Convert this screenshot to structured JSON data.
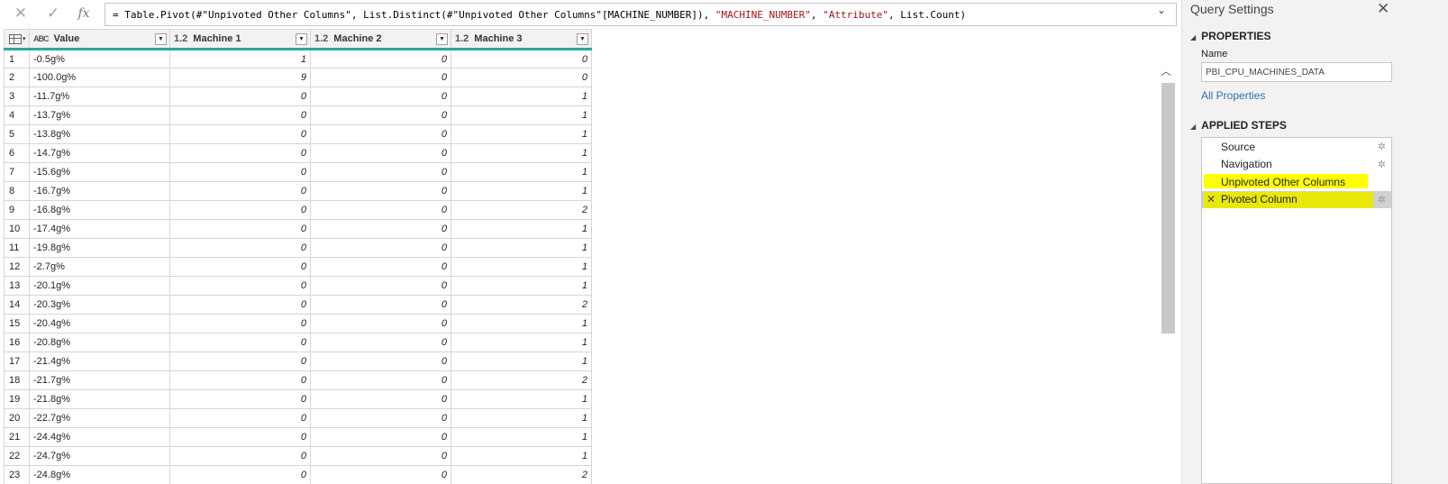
{
  "formula_bar": {
    "cancel_icon": "close-icon",
    "commit_icon": "check-icon",
    "fx_label": "fx",
    "formula_parts": [
      {
        "text": "= Table.Pivot(#\"Unpivoted Other Columns\", List.Distinct(#\"Unpivoted Other Columns\"[MACHINE_NUMBER]), ",
        "kind": "code"
      },
      {
        "text": "\"MACHINE_NUMBER\"",
        "kind": "string"
      },
      {
        "text": ", ",
        "kind": "code"
      },
      {
        "text": "\"Attribute\"",
        "kind": "string"
      },
      {
        "text": ", List.Count)",
        "kind": "code"
      }
    ]
  },
  "grid": {
    "columns": [
      {
        "type_label": "ABC",
        "name": "Value"
      },
      {
        "type_label": "1.2",
        "name": "Machine 1"
      },
      {
        "type_label": "1.2",
        "name": "Machine 2"
      },
      {
        "type_label": "1.2",
        "name": "Machine 3"
      }
    ],
    "rows": [
      [
        "1",
        "-0.5g%",
        "1",
        "0",
        "0"
      ],
      [
        "2",
        "-100.0g%",
        "9",
        "0",
        "0"
      ],
      [
        "3",
        "-11.7g%",
        "0",
        "0",
        "1"
      ],
      [
        "4",
        "-13.7g%",
        "0",
        "0",
        "1"
      ],
      [
        "5",
        "-13.8g%",
        "0",
        "0",
        "1"
      ],
      [
        "6",
        "-14.7g%",
        "0",
        "0",
        "1"
      ],
      [
        "7",
        "-15.6g%",
        "0",
        "0",
        "1"
      ],
      [
        "8",
        "-16.7g%",
        "0",
        "0",
        "1"
      ],
      [
        "9",
        "-16.8g%",
        "0",
        "0",
        "2"
      ],
      [
        "10",
        "-17.4g%",
        "0",
        "0",
        "1"
      ],
      [
        "11",
        "-19.8g%",
        "0",
        "0",
        "1"
      ],
      [
        "12",
        "-2.7g%",
        "0",
        "0",
        "1"
      ],
      [
        "13",
        "-20.1g%",
        "0",
        "0",
        "1"
      ],
      [
        "14",
        "-20.3g%",
        "0",
        "0",
        "2"
      ],
      [
        "15",
        "-20.4g%",
        "0",
        "0",
        "1"
      ],
      [
        "16",
        "-20.8g%",
        "0",
        "0",
        "1"
      ],
      [
        "17",
        "-21.4g%",
        "0",
        "0",
        "1"
      ],
      [
        "18",
        "-21.7g%",
        "0",
        "0",
        "2"
      ],
      [
        "19",
        "-21.8g%",
        "0",
        "0",
        "1"
      ],
      [
        "20",
        "-22.7g%",
        "0",
        "0",
        "1"
      ],
      [
        "21",
        "-24.4g%",
        "0",
        "0",
        "1"
      ],
      [
        "22",
        "-24.7g%",
        "0",
        "0",
        "1"
      ],
      [
        "23",
        "-24.8g%",
        "0",
        "0",
        "2"
      ]
    ]
  },
  "query_settings": {
    "title": "Query Settings",
    "properties_header": "PROPERTIES",
    "name_label": "Name",
    "name_value": "PBI_CPU_MACHINES_DATA",
    "all_properties_link": "All Properties",
    "applied_steps_header": "APPLIED STEPS",
    "steps": [
      {
        "label": "Source",
        "gear": true,
        "highlight": "none"
      },
      {
        "label": "Navigation",
        "gear": true,
        "highlight": "none"
      },
      {
        "label": "Unpivoted Other Columns",
        "gear": false,
        "highlight": "yellow"
      },
      {
        "label": "Pivoted Column",
        "gear": true,
        "highlight": "selected"
      }
    ]
  },
  "colors": {
    "header_accent": "#2ba89a",
    "highlight_yellow": "#ffff00",
    "link_blue": "#2c6fb3",
    "string_red": "#a31515"
  }
}
